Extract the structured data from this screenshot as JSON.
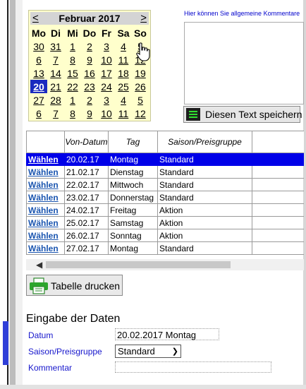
{
  "calendar": {
    "prev": "<",
    "next": ">",
    "title": "Februar 2017",
    "weekdays": [
      "Mo",
      "Di",
      "Mi",
      "Do",
      "Fr",
      "Sa",
      "So"
    ],
    "weeks": [
      [
        "30",
        "31",
        "1",
        "2",
        "3",
        "4",
        "5"
      ],
      [
        "6",
        "7",
        "8",
        "9",
        "10",
        "11",
        "12"
      ],
      [
        "13",
        "14",
        "15",
        "16",
        "17",
        "18",
        "19"
      ],
      [
        "20",
        "21",
        "22",
        "23",
        "24",
        "25",
        "26"
      ],
      [
        "27",
        "28",
        "1",
        "2",
        "3",
        "4",
        "5"
      ],
      [
        "6",
        "7",
        "8",
        "9",
        "10",
        "11",
        "12"
      ]
    ],
    "selected_day": "20"
  },
  "comment": {
    "label": "Hier können Sie allgemeine Kommentare",
    "save_button": "Diesen Text speichern"
  },
  "table": {
    "headers": [
      "",
      "Von-Datum",
      "Tag",
      "Saison/Preisgruppe",
      ""
    ],
    "rows": [
      {
        "action": "Wählen",
        "date": "20.02.17",
        "day": "Montag",
        "season": "Standard",
        "selected": true
      },
      {
        "action": "Wählen",
        "date": "21.02.17",
        "day": "Dienstag",
        "season": "Standard",
        "selected": false
      },
      {
        "action": "Wählen",
        "date": "22.02.17",
        "day": "Mittwoch",
        "season": "Standard",
        "selected": false
      },
      {
        "action": "Wählen",
        "date": "23.02.17",
        "day": "Donnerstag",
        "season": "Standard",
        "selected": false
      },
      {
        "action": "Wählen",
        "date": "24.02.17",
        "day": "Freitag",
        "season": "Aktion",
        "selected": false
      },
      {
        "action": "Wählen",
        "date": "25.02.17",
        "day": "Samstag",
        "season": "Aktion",
        "selected": false
      },
      {
        "action": "Wählen",
        "date": "26.02.17",
        "day": "Sonntag",
        "season": "Aktion",
        "selected": false
      },
      {
        "action": "Wählen",
        "date": "27.02.17",
        "day": "Montag",
        "season": "Standard",
        "selected": false
      }
    ]
  },
  "print_button": "Tabelle drucken",
  "form": {
    "heading": "Eingabe der Daten",
    "datum_label": "Datum",
    "datum_value": "20.02.2017 Montag",
    "saison_label": "Saison/Preisgruppe",
    "saison_value": "Standard",
    "kommentar_label": "Kommentar",
    "kommentar_value": ""
  },
  "colors": {
    "selection": "#0000e8",
    "link": "#1a55b0",
    "label_blue": "#1515cc",
    "calendar_bg": "#ffffcc"
  },
  "icons": [
    "save-icon",
    "printer-icon",
    "hand-cursor-icon",
    "scroll-left-icon",
    "chevron-down-icon"
  ]
}
